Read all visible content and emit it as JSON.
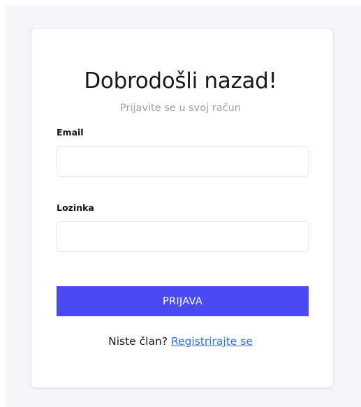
{
  "login": {
    "title": "Dobrodošli nazad!",
    "subtitle": "Prijavite se u svoj račun",
    "email": {
      "label": "Email",
      "value": "",
      "placeholder": ""
    },
    "password": {
      "label": "Lozinka",
      "value": "",
      "placeholder": ""
    },
    "submit_label": "PRIJAVA",
    "footer": {
      "prompt": "Niste član?",
      "link_label": "Registrirajte se"
    }
  },
  "colors": {
    "page_background": "#f4f6f9",
    "card_background": "#ffffff",
    "accent": "#4a49f2",
    "link": "#2f6fe0",
    "subtitle": "#9aa0aa"
  }
}
